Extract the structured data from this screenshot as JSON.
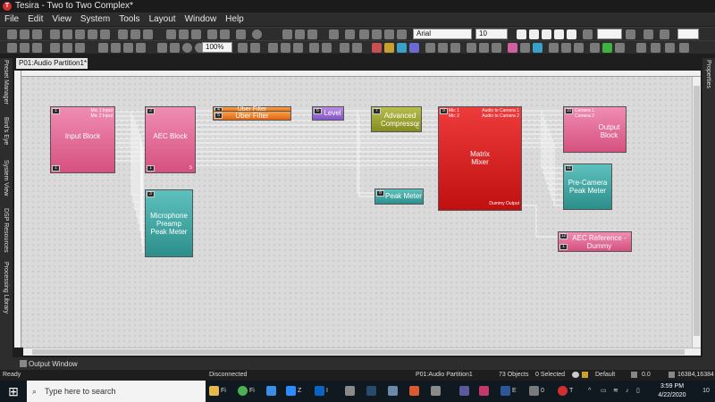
{
  "window": {
    "title": "Tesira - Two to Two Complex*",
    "app_icon": "T"
  },
  "menu": [
    "File",
    "Edit",
    "View",
    "System",
    "Tools",
    "Layout",
    "Window",
    "Help"
  ],
  "toolbar": {
    "font": "Arial",
    "font_size": "10",
    "zoom": "100%"
  },
  "document_tab": "P01:Audio Partition1*",
  "side_panels": {
    "left": [
      "Preset Manager",
      "Bird's Eye",
      "System View",
      "DSP Resources",
      "Processing Library"
    ],
    "right": "Properties"
  },
  "blocks": {
    "input": {
      "name": "Input Block",
      "num": "1",
      "pin_out": "Mic 1 Input\nMic 2 Input",
      "foot": "1"
    },
    "aec": {
      "name": "AEC Block",
      "num": "2",
      "foot": "1",
      "foot_right": "S"
    },
    "mic_meter": {
      "name": "Microphone Preamp Peak Meter",
      "num": "3"
    },
    "uber1": {
      "name": "Uber Filter",
      "num": "4"
    },
    "uber2": {
      "name": "Uber Filter",
      "num": "5"
    },
    "level": {
      "name": "Level",
      "num": "6"
    },
    "compressor": {
      "name": "Advanced Compressor",
      "num": "7",
      "foot": "C"
    },
    "peak": {
      "name": "Peak Meter",
      "num": "8"
    },
    "matrix": {
      "name": "Matrix Mixer",
      "num": "9",
      "in": "Mic 1\nMic 2",
      "out": "Audio to Camera 1\nAudio to Camera 2",
      "dummy": "Dummy Output"
    },
    "output": {
      "name": "Output Block",
      "num": "10",
      "in": "Camera 1\nCamera 2"
    },
    "precam": {
      "name": "Pre-Camera Peak Meter",
      "num": "11"
    },
    "aecref": {
      "name": "AEC Reference - Dummy",
      "num": "12",
      "foot": "1"
    }
  },
  "output_window": "Output Window",
  "status": {
    "ready": "Ready",
    "connection": "Disconnected",
    "partition": "P01:Audio Partition1",
    "objects": "73 Objects",
    "selected": "0 Selected",
    "preset": "Default",
    "value": "0.0",
    "coords": "16384,16384"
  },
  "taskbar": {
    "search_placeholder": "Type here to search",
    "time": "3:59 PM",
    "date": "4/22/2020",
    "notifications": "10"
  },
  "colors": {
    "accent_red": "#d32f2f",
    "canvas": "#dadada"
  }
}
